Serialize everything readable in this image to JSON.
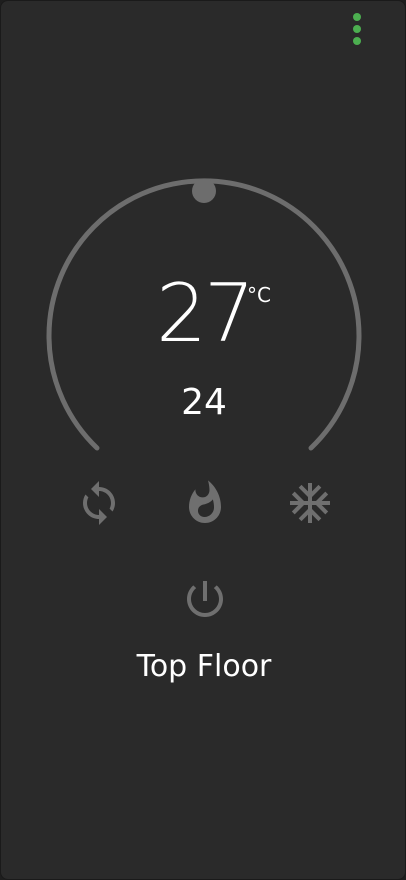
{
  "thermostat": {
    "current_temperature": "27",
    "unit": "°C",
    "target_temperature": "24",
    "target_fraction": 0.5,
    "name": "Top Floor"
  },
  "icons": {
    "menu": "more-vertical-icon",
    "auto": "sync-icon",
    "heat": "fire-icon",
    "cool": "snowflake-icon",
    "power": "power-icon"
  },
  "colors": {
    "background": "#2a2a2a",
    "menu_dots": "#4caf50",
    "arc": "#6d6d6d",
    "handle": "#6d6d6d",
    "icon": "#6f6f6f",
    "text": "#ffffff"
  }
}
